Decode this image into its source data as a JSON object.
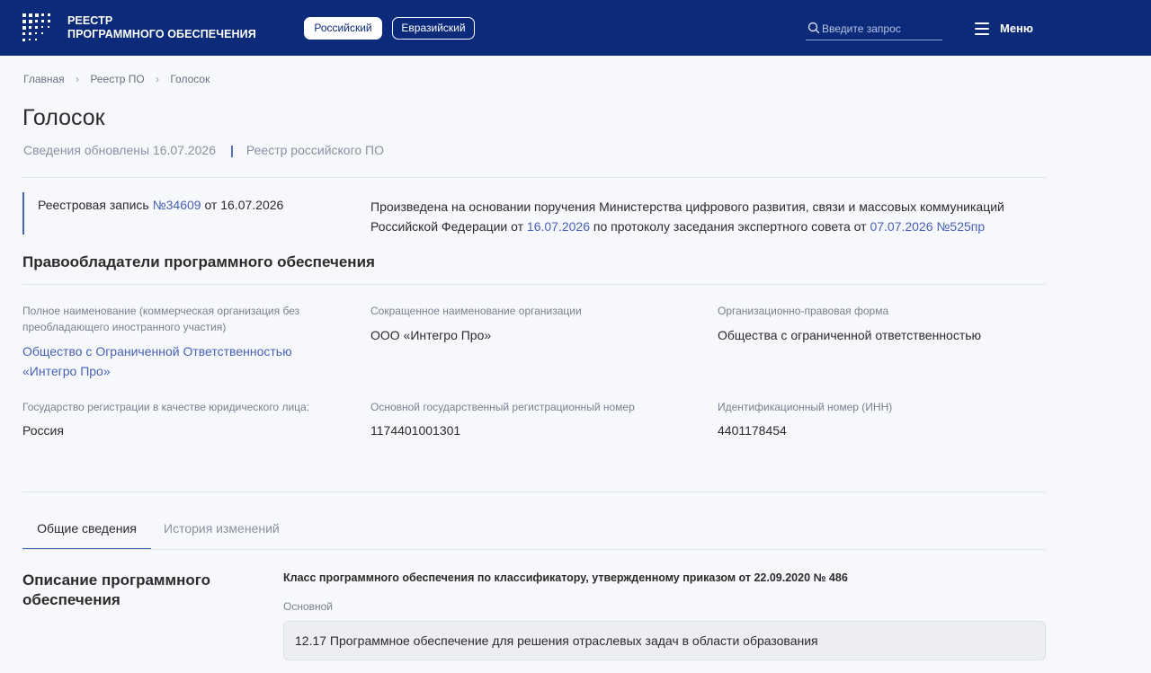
{
  "header": {
    "brand_line1": "РЕЕСТР",
    "brand_line2": "ПРОГРАММНОГО ОБЕСПЕЧЕНИЯ",
    "registry_tabs": [
      "Российский",
      "Евразийский"
    ],
    "search_placeholder": "Введите запрос",
    "menu_label": "Меню",
    "colors": {
      "header_bg": "#0b2a7a",
      "accent": "#4761b8"
    }
  },
  "breadcrumb": [
    "Главная",
    "Реестр ПО",
    "Голосок"
  ],
  "page": {
    "title": "Голосок",
    "updated": "Сведения обновлены 16.07.2026",
    "registry": "Реестр российского ПО",
    "meta_separator": "|"
  },
  "record": {
    "prefix": "Реестровая запись ",
    "number": "№34609",
    "suffix": " от 16.07.2026",
    "basis_text1": "Произведена на основании поручения Министерства цифрового развития, связи и массовых коммуникаций Российской Федерации от ",
    "basis_date": "16.07.2026",
    "basis_text2": " по протоколу заседания экспертного совета от ",
    "basis_protocol": "07.07.2026 №525пр"
  },
  "owners": {
    "heading": "Правообладатели программного обеспечения",
    "fields": [
      {
        "label": "Полное наименование (коммерческая организация без преобладающего иностранного участия)",
        "value": "Общество с Ограниченной Ответственностью «Интегро Про»"
      },
      {
        "label": "Сокращенное наименование организации",
        "value": "ООО «Интегро Про»"
      },
      {
        "label": "Организационно-правовая форма",
        "value": "Общества с ограниченной ответственностью"
      },
      {
        "label": "Государство регистрации в качестве юридического лица:",
        "value": "Россия"
      },
      {
        "label": "Основной государственный регистрационный номер",
        "value": "1174401001301"
      },
      {
        "label": "Идентификационный номер (ИНН)",
        "value": "4401178454"
      }
    ]
  },
  "tabs": [
    "Общие сведения",
    "История изменений"
  ],
  "description": {
    "title": "Описание программного обеспечения",
    "class_heading": "Класс программного обеспечения по классификатору, утвержденному приказом от 22.09.2020 № 486",
    "class_sub": "Основной",
    "class_value": "12.17 Программное обеспечение для решения отраслевых задач в области образования"
  }
}
